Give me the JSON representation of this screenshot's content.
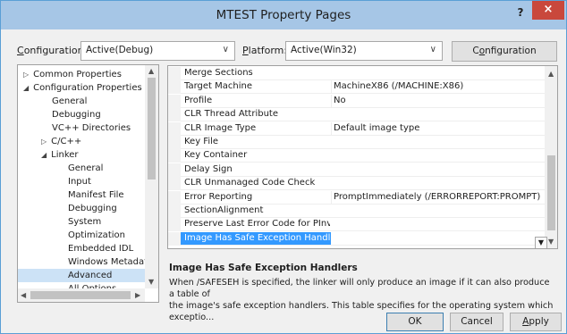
{
  "window": {
    "title": "MTEST Property Pages",
    "help_label": "?",
    "close_label": "×"
  },
  "config_bar": {
    "configuration_label_u": "C",
    "configuration_label_rest": "onfiguration:",
    "configuration_value": "Active(Debug)",
    "platform_label_u": "P",
    "platform_label_rest": "latform:",
    "platform_value": "Active(Win32)",
    "manager_pre": "C",
    "manager_u": "o",
    "manager_rest": "nfiguration Manager..."
  },
  "tree": {
    "items": [
      {
        "label": "Common Properties",
        "glyph": "▷"
      },
      {
        "label": "Configuration Properties",
        "glyph": "◢"
      },
      {
        "label": "General",
        "glyph": ""
      },
      {
        "label": "Debugging",
        "glyph": ""
      },
      {
        "label": "VC++ Directories",
        "glyph": ""
      },
      {
        "label": "C/C++",
        "glyph": "▷"
      },
      {
        "label": "Linker",
        "glyph": "◢"
      },
      {
        "label": "General",
        "glyph": ""
      },
      {
        "label": "Input",
        "glyph": ""
      },
      {
        "label": "Manifest File",
        "glyph": ""
      },
      {
        "label": "Debugging",
        "glyph": ""
      },
      {
        "label": "System",
        "glyph": ""
      },
      {
        "label": "Optimization",
        "glyph": ""
      },
      {
        "label": "Embedded IDL",
        "glyph": ""
      },
      {
        "label": "Windows Metadata",
        "glyph": ""
      },
      {
        "label": "Advanced",
        "glyph": ""
      },
      {
        "label": "All Options",
        "glyph": ""
      }
    ],
    "selected_index": 15
  },
  "grid": {
    "rows": [
      {
        "name": "Merge Sections",
        "value": ""
      },
      {
        "name": "Target Machine",
        "value": "MachineX86 (/MACHINE:X86)"
      },
      {
        "name": "Profile",
        "value": "No"
      },
      {
        "name": "CLR Thread Attribute",
        "value": ""
      },
      {
        "name": "CLR Image Type",
        "value": "Default image type"
      },
      {
        "name": "Key File",
        "value": ""
      },
      {
        "name": "Key Container",
        "value": ""
      },
      {
        "name": "Delay Sign",
        "value": ""
      },
      {
        "name": "CLR Unmanaged Code Check",
        "value": ""
      },
      {
        "name": "Error Reporting",
        "value": "PromptImmediately (/ERRORREPORT:PROMPT)"
      },
      {
        "name": "SectionAlignment",
        "value": ""
      },
      {
        "name": "Preserve Last Error Code for PInvoke",
        "value": ""
      },
      {
        "name": "Image Has Safe Exception Handlers",
        "value": ""
      }
    ],
    "selected_index": 12
  },
  "description": {
    "title": "Image Has Safe Exception Handlers",
    "text": "When /SAFESEH is specified, the linker will only produce an image if it can also produce a table of\nthe image's safe exception handlers. This table specifies for the operating system which exceptio..."
  },
  "buttons": {
    "ok": "OK",
    "cancel": "Cancel",
    "apply_u": "A",
    "apply_rest": "pply"
  },
  "colors": {
    "title_bar": "#a6c6e6",
    "close": "#c9483c",
    "selection": "#3399ff",
    "tree_selection": "#cce2f6"
  }
}
